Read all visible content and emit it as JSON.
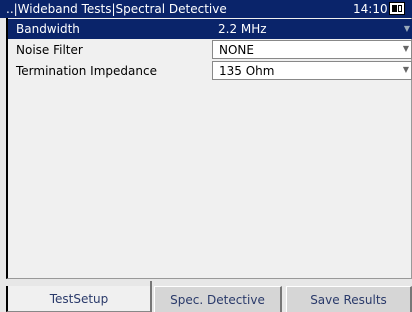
{
  "titlebar": {
    "title": "..|Wideband Tests|Spectral Detective",
    "time": "14:10",
    "icon": "battery-icon"
  },
  "settings": [
    {
      "label": "Bandwidth",
      "value": "2.2 MHz",
      "selected": true
    },
    {
      "label": "Noise Filter",
      "value": "NONE",
      "selected": false
    },
    {
      "label": "Termination Impedance",
      "value": "135 Ohm",
      "selected": false
    }
  ],
  "tabs": [
    {
      "label": "TestSetup",
      "active": true
    },
    {
      "label": "Spec. Detective",
      "active": false
    },
    {
      "label": "Save Results",
      "active": false
    }
  ],
  "colors": {
    "selection": "#0a246a",
    "panel": "#f0f0f0",
    "tab_text": "#2a3a6a"
  }
}
